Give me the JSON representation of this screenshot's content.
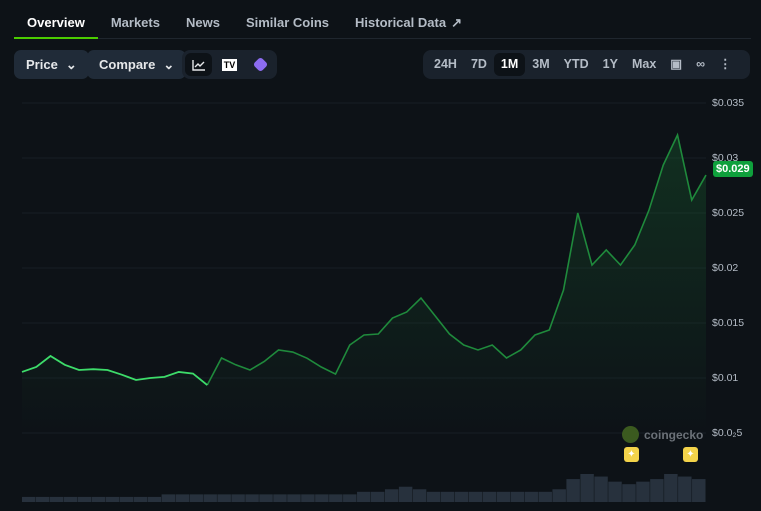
{
  "tabs": [
    "Overview",
    "Markets",
    "News",
    "Similar Coins",
    "Historical Data"
  ],
  "toolbar": {
    "price_label": "Price",
    "compare_label": "Compare",
    "tv_label": "TV",
    "ranges": [
      "24H",
      "7D",
      "1M",
      "3M",
      "YTD",
      "1Y",
      "Max"
    ],
    "active_range": "1M"
  },
  "watermark": "coingecko",
  "current_price": "$0.029",
  "colors": {
    "line_highlight": "#3ddc6a",
    "line": "#1f8a3c",
    "badge": "#0fa03c",
    "accent": "#4bcc00"
  },
  "chart_data": {
    "type": "line",
    "title": "",
    "y_tick_labels": [
      "$0.035",
      "$0.03",
      "$0.025",
      "$0.02",
      "$0.015",
      "$0.01",
      "$0.0₂5"
    ],
    "ylim": [
      0.005,
      0.035
    ],
    "grid": true,
    "values": [
      0.01055,
      0.011,
      0.012,
      0.0112,
      0.01073,
      0.0108,
      0.01073,
      0.0103,
      0.00982,
      0.01,
      0.0101,
      0.01055,
      0.0104,
      0.00936,
      0.01182,
      0.0112,
      0.01073,
      0.0115,
      0.01255,
      0.01236,
      0.0118,
      0.011,
      0.01036,
      0.013,
      0.01391,
      0.014,
      0.01545,
      0.016,
      0.01727,
      0.01564,
      0.014,
      0.013,
      0.01255,
      0.013,
      0.01182,
      0.01255,
      0.01391,
      0.01436,
      0.018,
      0.025,
      0.02027,
      0.02164,
      0.02027,
      0.02209,
      0.02527,
      0.02936,
      0.03209,
      0.02618,
      0.02845
    ],
    "highlight_until_index": 13,
    "volume": [
      2,
      2,
      2,
      2,
      2,
      2,
      2,
      2,
      2,
      2,
      3,
      3,
      3,
      3,
      3,
      3,
      3,
      3,
      3,
      3,
      3,
      3,
      3,
      3,
      4,
      4,
      5,
      6,
      5,
      4,
      4,
      4,
      4,
      4,
      4,
      4,
      4,
      4,
      5,
      9,
      11,
      10,
      8,
      7,
      8,
      9,
      11,
      10,
      9
    ]
  }
}
